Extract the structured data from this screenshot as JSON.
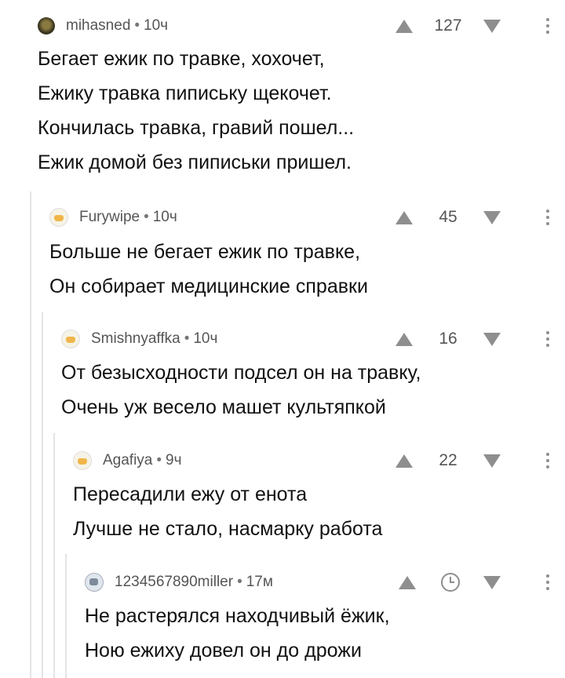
{
  "comments": [
    {
      "author": "mihasned",
      "time": "10ч",
      "rating": "127",
      "lines": [
        "Бегает ежик по травке, хохочет,",
        "Ежику травка пипиську щекочет.",
        "Кончилась травка, гравий пошел...",
        "Ежик домой без пиписьки пришел."
      ]
    },
    {
      "author": "Furywipe",
      "time": "10ч",
      "rating": "45",
      "lines": [
        "Больше не бегает ежик по травке,",
        "Он собирает медицинские справки"
      ]
    },
    {
      "author": "Smishnyaffka",
      "time": "10ч",
      "rating": "16",
      "lines": [
        "От безысходности подсел он на травку,",
        "Очень уж весело машет культяпкой"
      ]
    },
    {
      "author": "Agafiya",
      "time": "9ч",
      "rating": "22",
      "lines": [
        "Пересадили ежу от енота",
        "Лучше не стало, насмарку работа"
      ]
    },
    {
      "author": "1234567890miller",
      "time": "17м",
      "rating": "",
      "lines": [
        "Не растерялся находчивый ёжик,",
        "Ною ежиху довел он до дрожи"
      ]
    }
  ],
  "separator": "•"
}
